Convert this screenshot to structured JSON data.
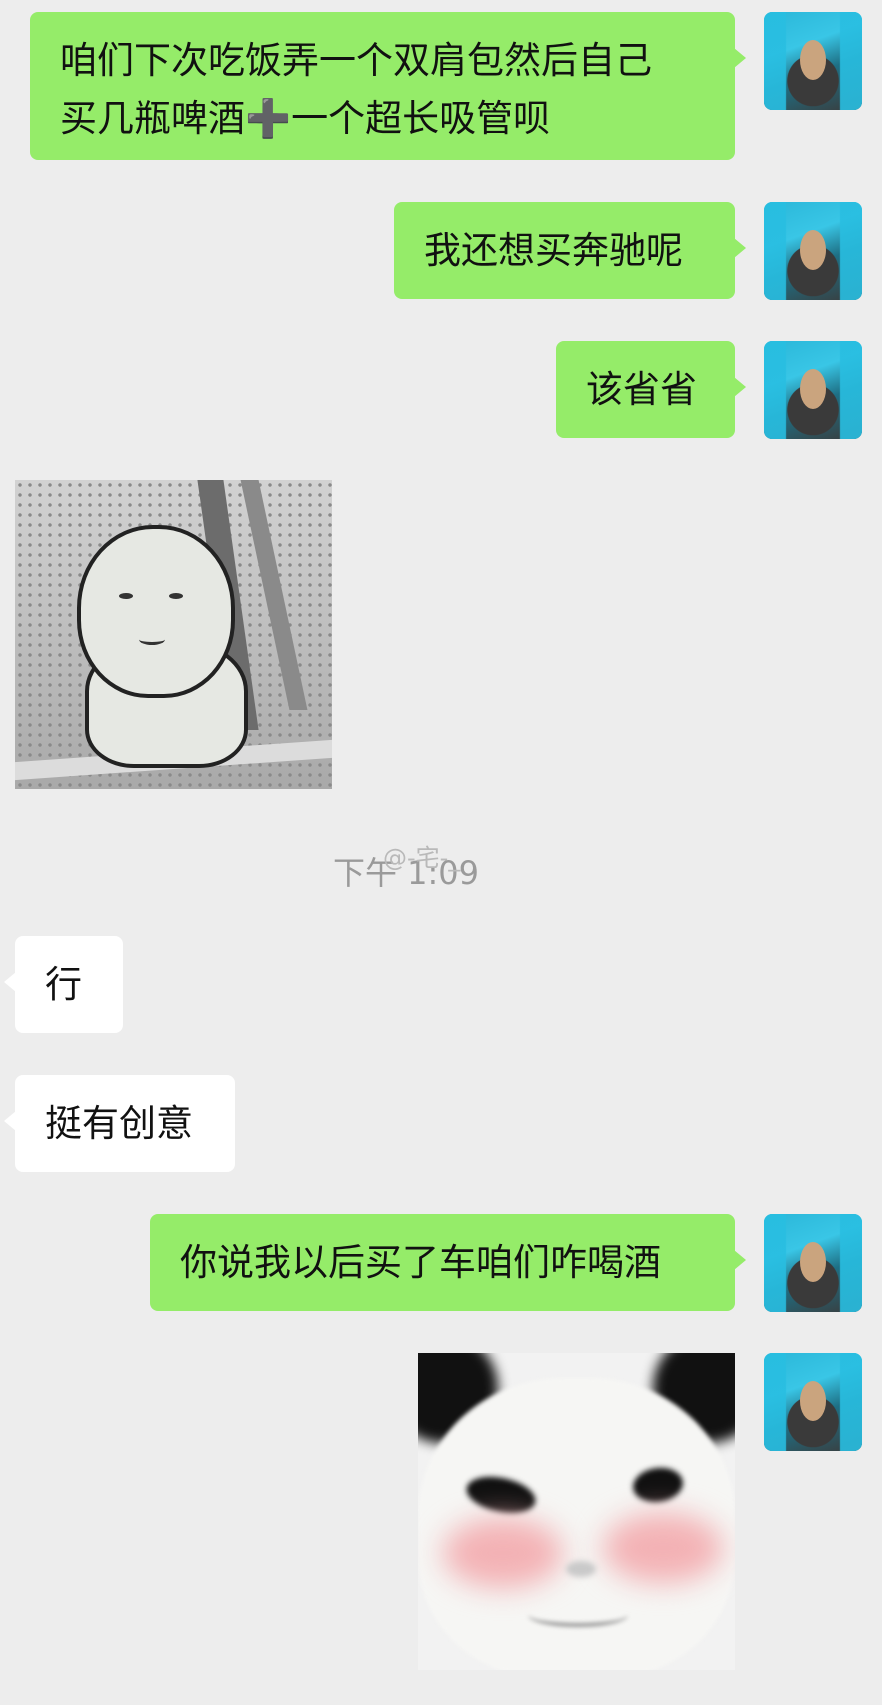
{
  "messages": [
    {
      "id": "m1",
      "sender": "me",
      "type": "text",
      "text": "咱们下次吃饭弄一个双肩包然后自己\n买几瓶啤酒➕一个超长吸管呗"
    },
    {
      "id": "m2",
      "sender": "me",
      "type": "text",
      "text": "我还想买奔驰呢"
    },
    {
      "id": "m3",
      "sender": "me",
      "type": "text",
      "text": "该省省"
    },
    {
      "id": "m4",
      "sender": "them",
      "type": "sticker",
      "sticker": "meme-figure-hugging-knees-on-bench"
    },
    {
      "id": "m5",
      "sender": "them",
      "type": "text",
      "text": "行"
    },
    {
      "id": "m6",
      "sender": "them",
      "type": "text",
      "text": "挺有创意"
    },
    {
      "id": "m7",
      "sender": "me",
      "type": "text",
      "text": "你说我以后买了车咱们咋喝酒"
    },
    {
      "id": "m8",
      "sender": "me",
      "type": "sticker",
      "sticker": "blushing-panda-face"
    }
  ],
  "timestamp": "下午 1:09",
  "watermark": "@-宅-_",
  "colors": {
    "background": "#ededed",
    "my_bubble": "#95ec69",
    "their_bubble": "#ffffff"
  }
}
